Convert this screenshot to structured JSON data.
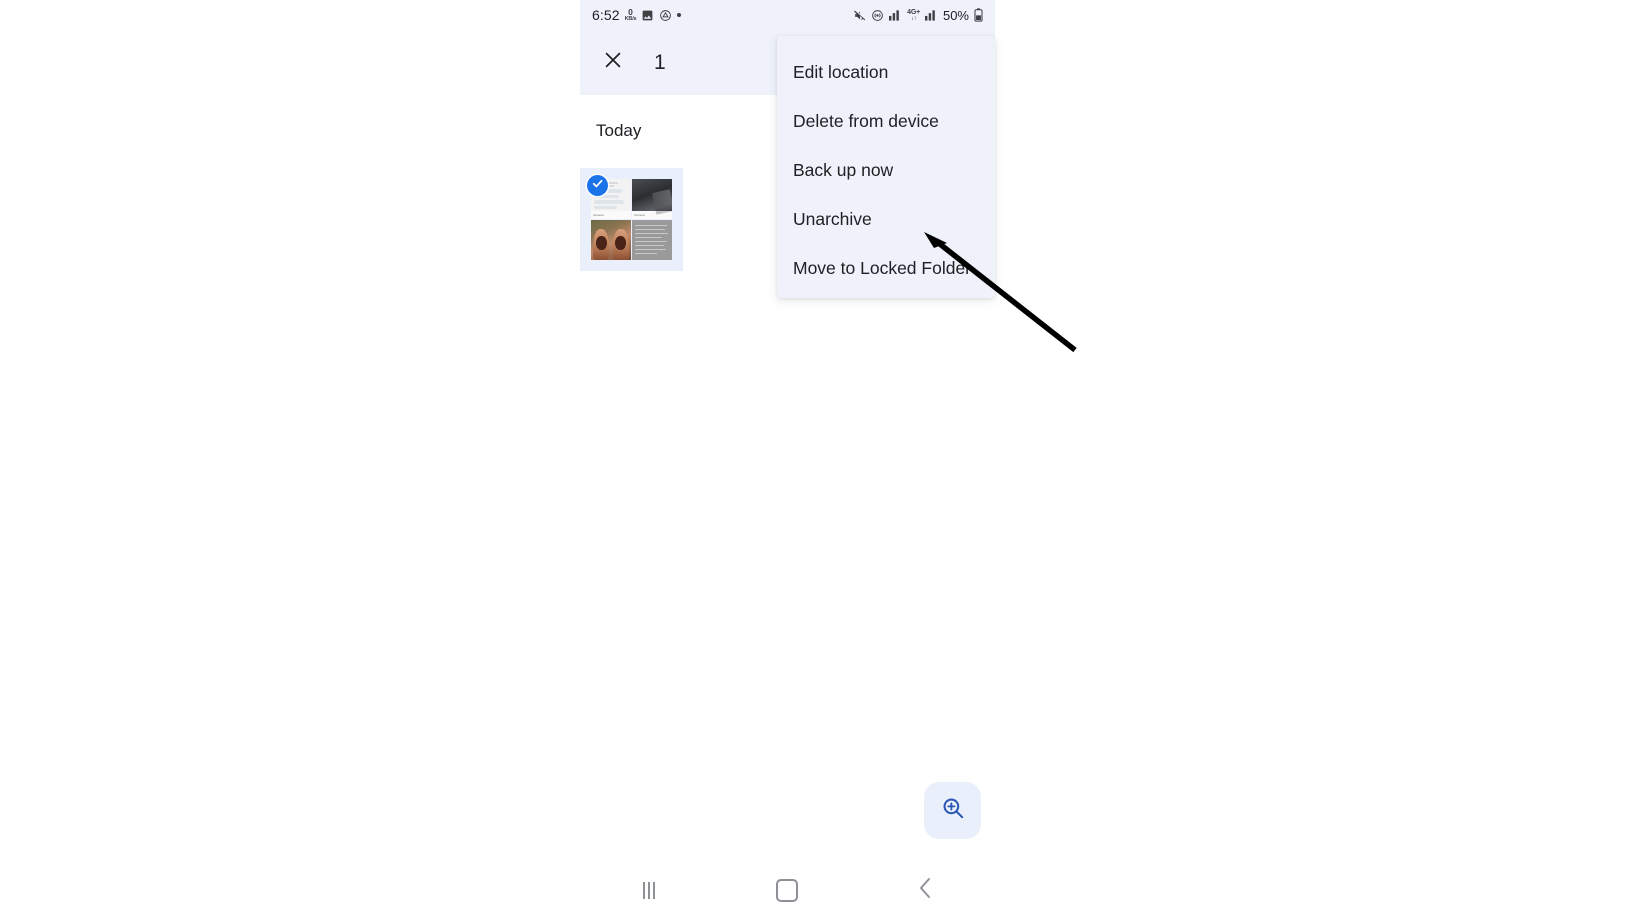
{
  "status_bar": {
    "time": "6:52",
    "data_rate_value": "0",
    "data_rate_unit": "KB/s",
    "left_icons": [
      "screenshot-icon",
      "cloud-drive-icon",
      "dot-indicator-icon"
    ],
    "right_icons": [
      "mute-icon",
      "hotspot-icon",
      "signal-bars-icon",
      "signal-bars-2-icon"
    ],
    "network_type": "4G+",
    "battery_percent": "50%"
  },
  "app_bar": {
    "close_icon": "close-icon",
    "selection_count": "1"
  },
  "content": {
    "section_header": "Today",
    "thumbnail": {
      "selected": true,
      "check_icon": "check-icon",
      "tile_captions": [
        "Camera",
        "Camera"
      ]
    }
  },
  "overflow_menu": {
    "items": [
      {
        "label": "Edit location"
      },
      {
        "label": "Delete from device"
      },
      {
        "label": "Back up now"
      },
      {
        "label": "Unarchive"
      },
      {
        "label": "Move to Locked Folder"
      }
    ]
  },
  "zoom_fab": {
    "icon": "zoom-in-icon"
  },
  "nav_bar": {
    "recents_label": "recents-icon",
    "home_label": "home-icon",
    "back_label": "back-icon"
  },
  "colors": {
    "app_bar_bg": "#eff2fb",
    "menu_bg": "#eff2fb",
    "accent_blue": "#1a73e8",
    "fab_bg": "#eaeffc",
    "text_primary": "#202124",
    "nav_icon": "#8d9095",
    "annotation": "#000000"
  }
}
